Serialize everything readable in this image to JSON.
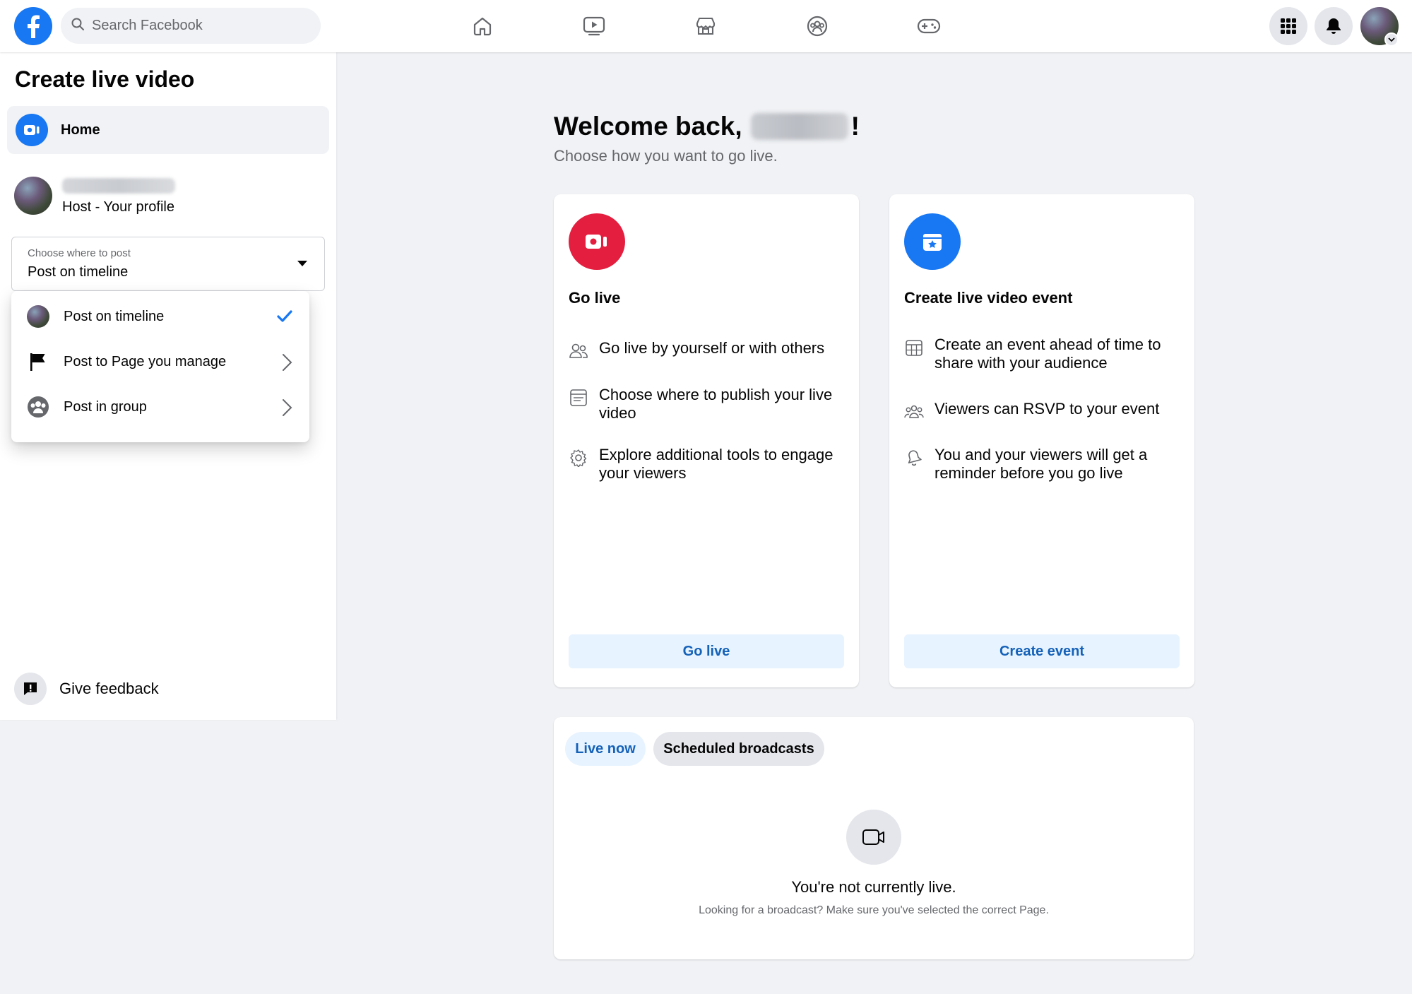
{
  "colors": {
    "brand": "#1877f2",
    "go_live_red": "#e41e3f",
    "link_blue": "#1461b8",
    "light_blue_bg": "#e7f3ff"
  },
  "topbar": {
    "search_placeholder": "Search Facebook",
    "nav_icons": [
      "home-icon",
      "watch-icon",
      "marketplace-icon",
      "groups-icon",
      "gaming-icon"
    ],
    "right_icons": [
      "menu-grid-icon",
      "notifications-bell-icon",
      "account-avatar"
    ]
  },
  "sidebar": {
    "title": "Create live video",
    "home_label": "Home",
    "host_role": "Host - Your profile",
    "post_select": {
      "label": "Choose where to post",
      "value": "Post on timeline"
    },
    "dropdown": [
      {
        "label": "Post on timeline",
        "selected": true
      },
      {
        "label": "Post to Page you manage",
        "selected": false
      },
      {
        "label": "Post in group",
        "selected": false
      }
    ],
    "feedback_label": "Give feedback"
  },
  "main": {
    "welcome_prefix": "Welcome back,",
    "welcome_suffix": "!",
    "subtitle": "Choose how you want to go live.",
    "go_live_card": {
      "title": "Go live",
      "features": [
        "Go live by yourself or with others",
        "Choose where to publish your live video",
        "Explore additional tools to engage your viewers"
      ],
      "button": "Go live"
    },
    "event_card": {
      "title": "Create live video event",
      "features": [
        "Create an event ahead of time to share with your audience",
        "Viewers can RSVP to your event",
        "You and your viewers will get a reminder before you go live"
      ],
      "button": "Create event"
    },
    "broadcasts": {
      "tabs": [
        "Live now",
        "Scheduled broadcasts"
      ],
      "active_tab": "Live now",
      "empty_title": "You're not currently live.",
      "empty_subtitle": "Looking for a broadcast? Make sure you've selected the correct Page."
    }
  }
}
